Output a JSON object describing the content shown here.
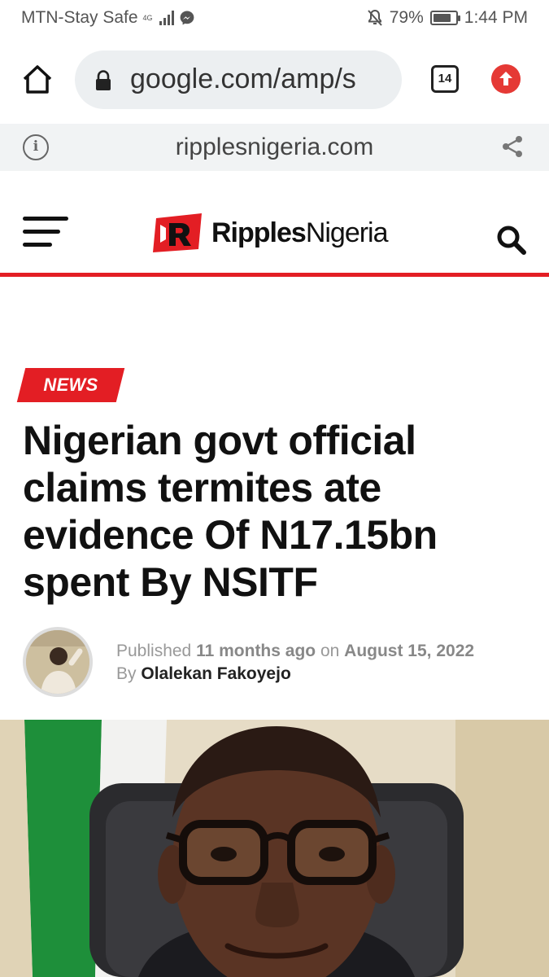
{
  "status_bar": {
    "carrier": "MTN-Stay Safe",
    "network_type": "4G",
    "battery_percent": "79%",
    "battery_level": 0.79,
    "time": "1:44 PM",
    "icons": [
      "signal-icon",
      "messenger-icon",
      "mute-bell-icon",
      "battery-icon"
    ]
  },
  "browser": {
    "url": "google.com/amp/s",
    "tab_count": "14",
    "site_domain": "ripplesnigeria.com",
    "icons": [
      "home-icon",
      "lock-icon",
      "upload-icon",
      "info-icon",
      "share-icon"
    ]
  },
  "site": {
    "logo_bold": "Ripples",
    "logo_regular": "Nigeria",
    "brand_color": "#e31e24",
    "icons": [
      "menu-icon",
      "search-icon"
    ]
  },
  "article": {
    "category": "NEWS",
    "headline": "Nigerian govt official claims termites ate evidence Of N17.15bn spent By NSITF",
    "published_label": "Published",
    "published_relative": "11 months ago",
    "on_label": "on",
    "published_date": "August 15, 2022",
    "by_label": "By",
    "author": "Olalekan Fakoyejo"
  }
}
